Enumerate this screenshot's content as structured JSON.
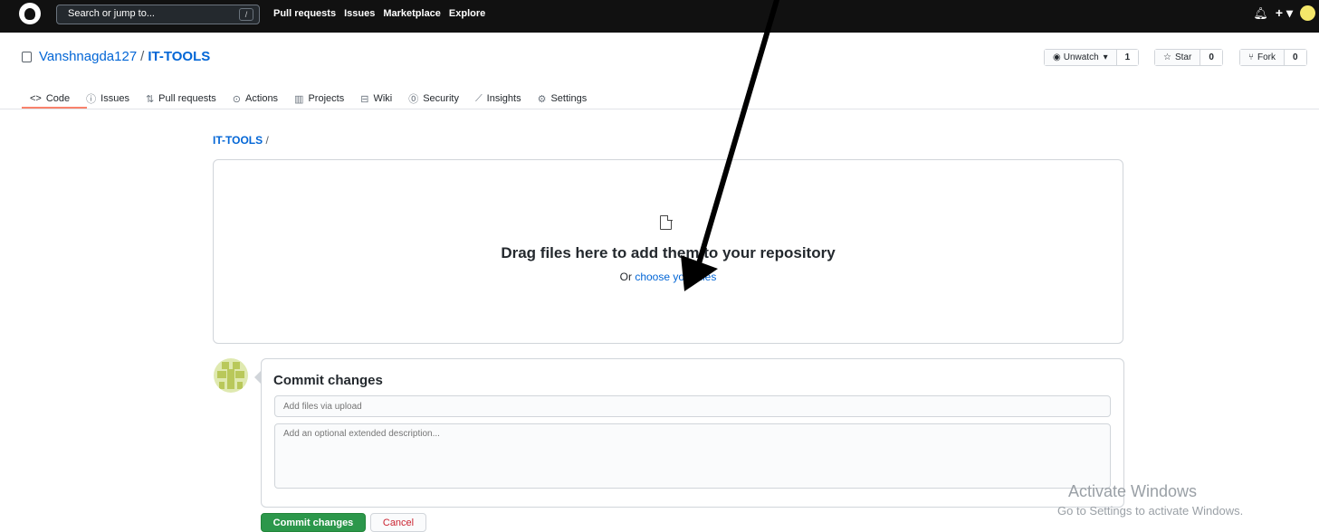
{
  "topbar": {
    "search_placeholder": "Search or jump to...",
    "search_key": "/",
    "nav": [
      "Pull requests",
      "Issues",
      "Marketplace",
      "Explore"
    ],
    "icons": [
      "bell-icon",
      "plus-icon",
      "avatar"
    ]
  },
  "repo": {
    "owner": "Vanshnagda127",
    "separator": "/",
    "name": "IT-TOOLS",
    "unwatch_label": "Unwatch",
    "unwatch_count": "1",
    "star_label": "Star",
    "star_count": "0",
    "fork_label": "Fork",
    "fork_count": "0"
  },
  "tabs": [
    {
      "icon": "code-icon",
      "label": "Code"
    },
    {
      "icon": "issues-icon",
      "label": "Issues"
    },
    {
      "icon": "pull-request-icon",
      "label": "Pull requests"
    },
    {
      "icon": "actions-icon",
      "label": "Actions"
    },
    {
      "icon": "projects-icon",
      "label": "Projects"
    },
    {
      "icon": "wiki-icon",
      "label": "Wiki"
    },
    {
      "icon": "security-icon",
      "label": "Security"
    },
    {
      "icon": "insights-icon",
      "label": "Insights"
    },
    {
      "icon": "settings-icon",
      "label": "Settings"
    }
  ],
  "breadcrumb": {
    "link": "IT-TOOLS",
    "slash": "/"
  },
  "dropzone": {
    "title": "Drag files here to add them to your repository",
    "sub_prefix": "Or",
    "sub_link": "choose your files"
  },
  "commit": {
    "title": "Commit changes",
    "summary_placeholder": "Add files via upload",
    "description_placeholder": "Add an optional extended description...",
    "commit_button": "Commit changes",
    "cancel_button": "Cancel"
  },
  "watermark": {
    "title": "Activate Windows",
    "subtitle": "Go to Settings to activate Windows."
  },
  "colors": {
    "link": "#0366d6",
    "commit_green": "#2c974b",
    "cancel_red": "#cb2431",
    "tab_active": "#f9826c",
    "topbar": "#111111"
  }
}
